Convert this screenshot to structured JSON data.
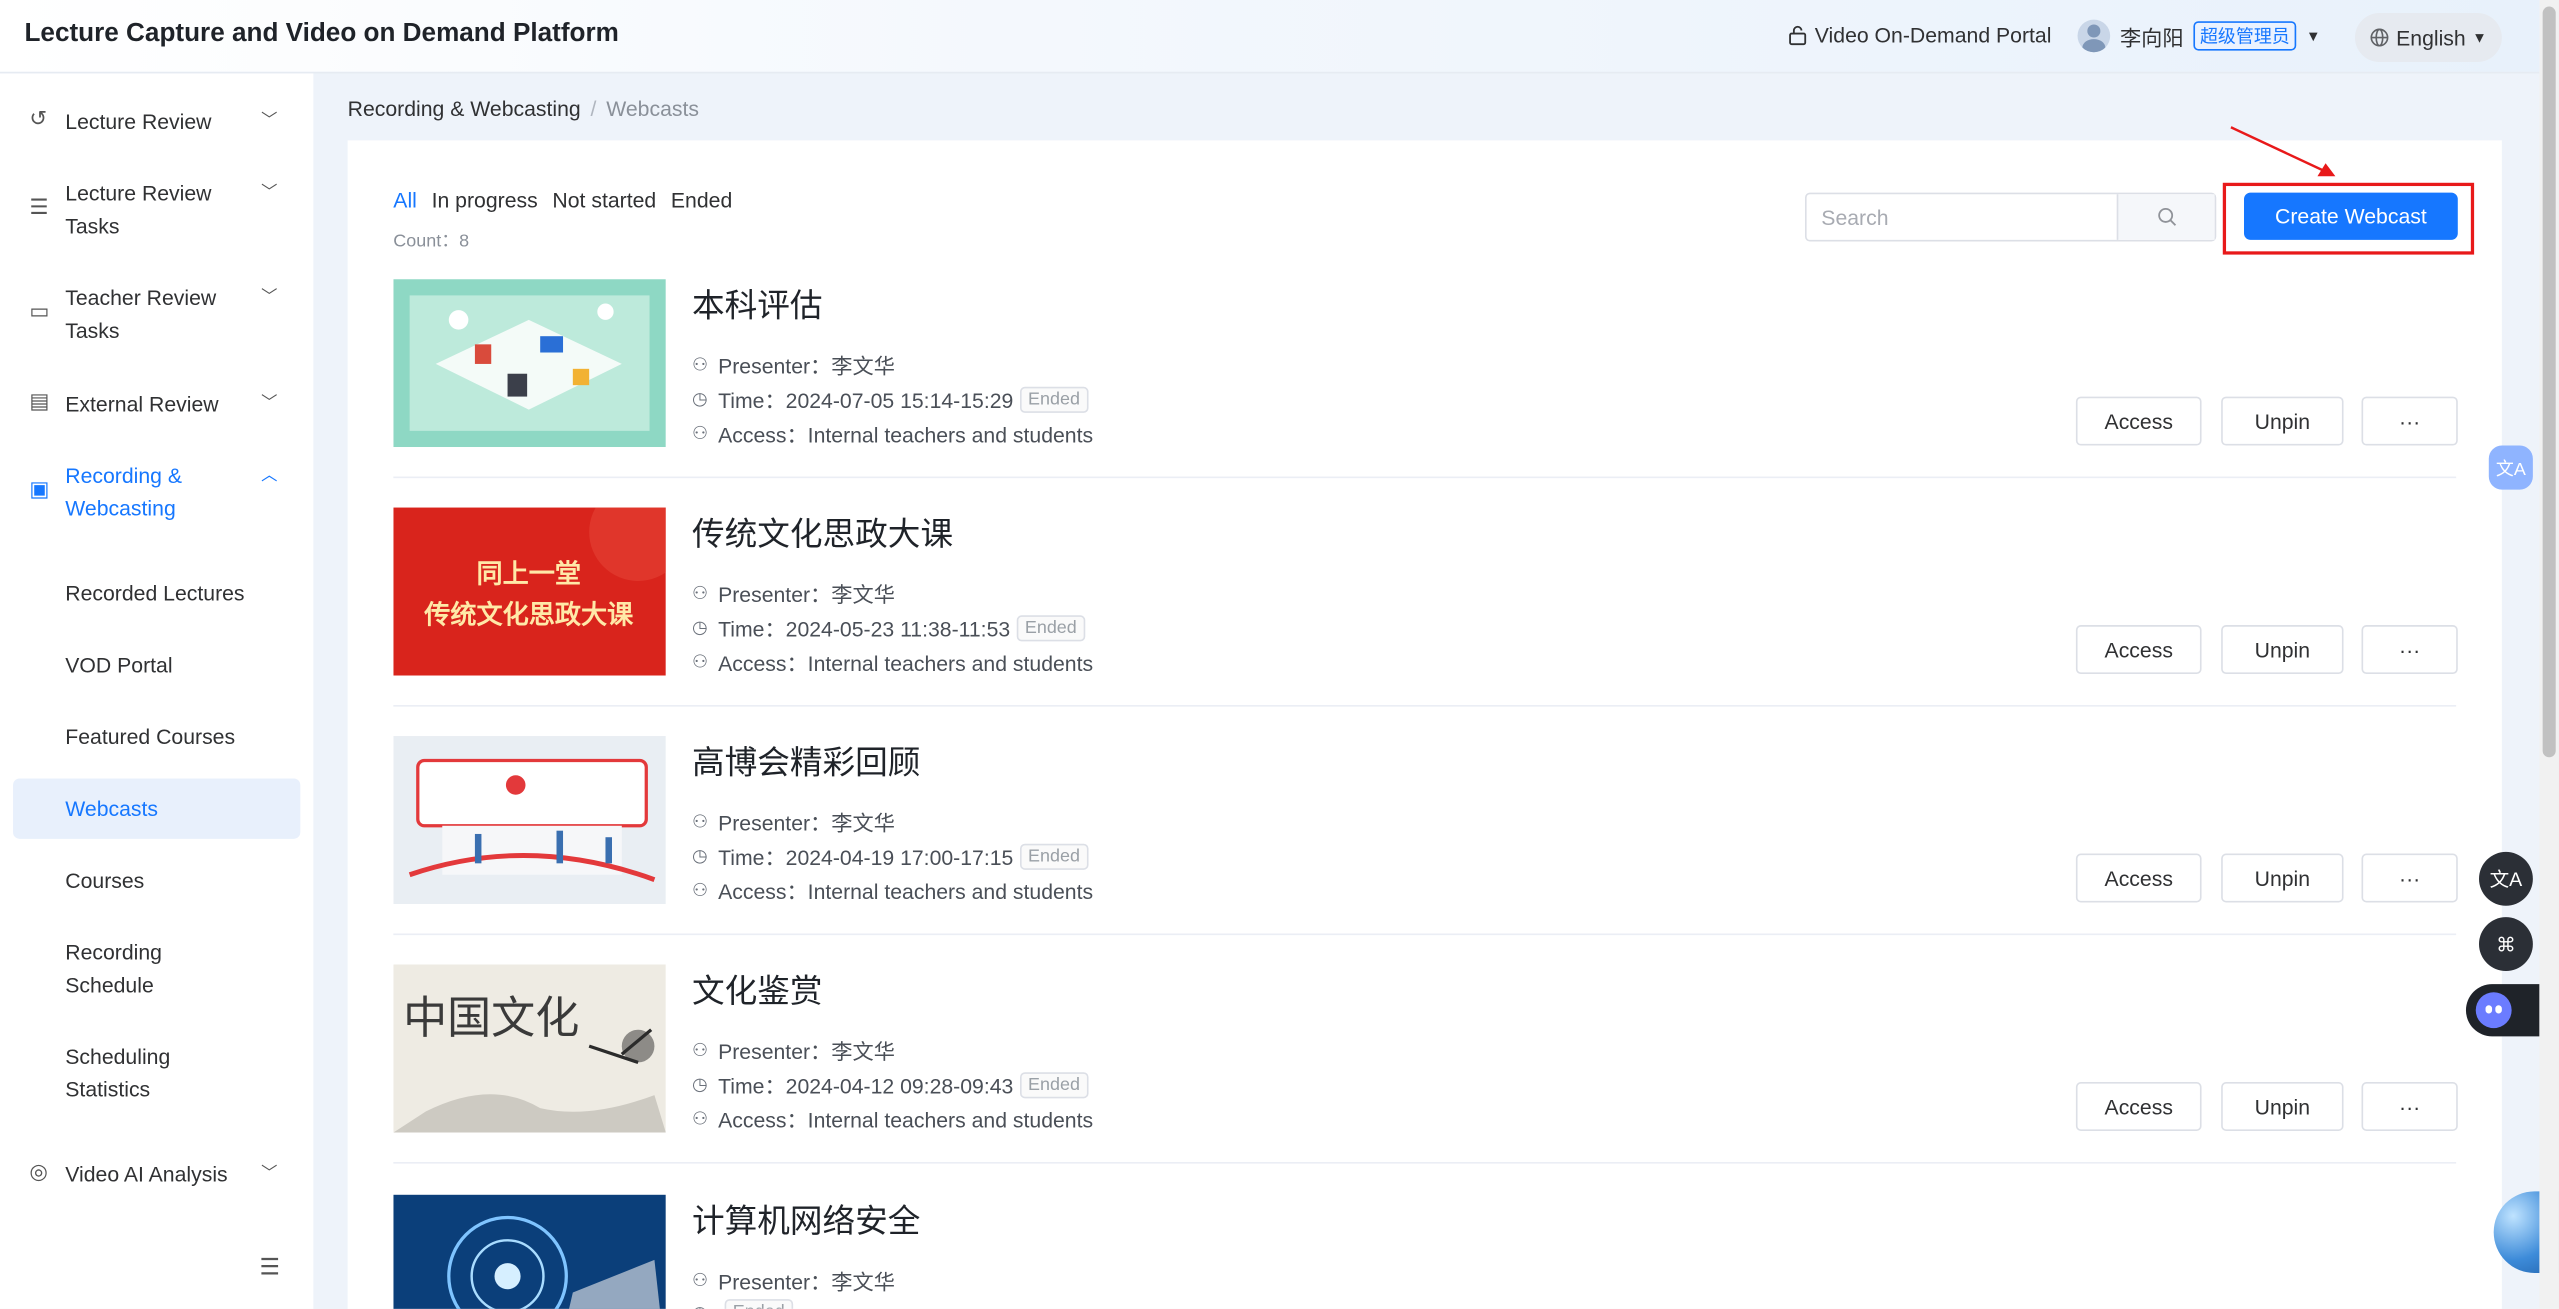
{
  "header": {
    "title": "Lecture Capture and Video on Demand Platform",
    "portal_label": "Video On-Demand Portal",
    "user_name": "李向阳",
    "user_role": "超级管理员",
    "language": "English"
  },
  "sidebar": {
    "items": [
      {
        "label": "Lecture Review",
        "icon": "history-icon"
      },
      {
        "label": "Lecture Review Tasks",
        "icon": "task-list-icon"
      },
      {
        "label": "Teacher Review Tasks",
        "icon": "comment-icon"
      },
      {
        "label": "External Review",
        "icon": "document-icon"
      },
      {
        "label": "Recording & Webcasting",
        "icon": "camera-icon"
      },
      {
        "label": "Video AI Analysis",
        "icon": "ai-icon"
      }
    ],
    "sub_items": [
      {
        "label": "Recorded Lectures"
      },
      {
        "label": "VOD Portal"
      },
      {
        "label": "Featured Courses"
      },
      {
        "label": "Webcasts"
      },
      {
        "label": "Courses"
      },
      {
        "label": "Recording Schedule"
      },
      {
        "label": "Scheduling Statistics"
      }
    ]
  },
  "breadcrumb": {
    "parent": "Recording & Webcasting",
    "separator": "/",
    "current": "Webcasts"
  },
  "filters": {
    "all": "All",
    "in_progress": "In progress",
    "not_started": "Not started",
    "ended": "Ended"
  },
  "count_label": "Count：8",
  "search": {
    "placeholder": "Search"
  },
  "create_button": "Create Webcast",
  "webcasts": [
    {
      "name": "本科评估",
      "presenter": "Presenter：李文华",
      "time": "Time：2024-07-05 15:14-15:29",
      "status": "Ended",
      "access": "Access：Internal teachers and students"
    },
    {
      "name": "传统文化思政大课",
      "presenter": "Presenter：李文华",
      "time": "Time：2024-05-23 11:38-11:53",
      "status": "Ended",
      "access": "Access：Internal teachers and students"
    },
    {
      "name": "高博会精彩回顾",
      "presenter": "Presenter：李文华",
      "time": "Time：2024-04-19 17:00-17:15",
      "status": "Ended",
      "access": "Access：Internal teachers and students"
    },
    {
      "name": "文化鉴赏",
      "presenter": "Presenter：李文华",
      "time": "Time：2024-04-12 09:28-09:43",
      "status": "Ended",
      "access": "Access：Internal teachers and students"
    },
    {
      "name": "计算机网络安全",
      "presenter": "Presenter：李文华",
      "time": "",
      "status": "Ended",
      "access": ""
    }
  ],
  "thumbnail_texts": {
    "banner_line1": "同上一堂",
    "banner_line2": "传统文化思政大课",
    "culture": "中国文化"
  },
  "row_buttons": {
    "access": "Access",
    "unpin": "Unpin",
    "more": "···"
  },
  "colors": {
    "accent": "#1677ff",
    "highlight": "#e8191a"
  }
}
